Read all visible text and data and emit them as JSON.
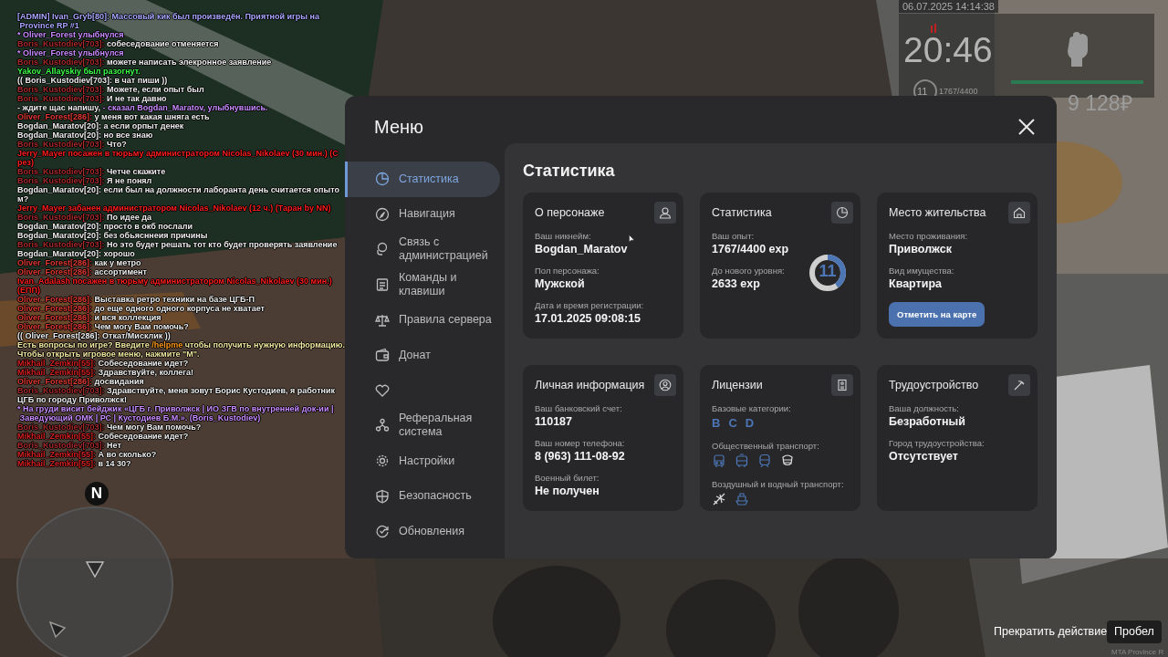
{
  "chat": [
    {
      "kind": "admin",
      "text": "[ADMIN] Ivan_Gryb[80]: Массовый кик был произведён. Приятной игры на"
    },
    {
      "kind": "admin",
      "text": " Province RP #1"
    },
    {
      "kind": "action",
      "text": "* Oliver_Forest улыбнулся"
    },
    {
      "kind": "say",
      "name": "Boris_Kustodiev[703]:",
      "color": "#a82a2a",
      "text": "собеседование отменяется"
    },
    {
      "kind": "action",
      "text": "* Oliver_Forest улыбнулся"
    },
    {
      "kind": "say",
      "name": "Boris_Kustodiev[703]:",
      "color": "#a82a2a",
      "text": "можете написать элекронное заявление"
    },
    {
      "kind": "event",
      "text": "Yakov_Allayskiy был разогнут."
    },
    {
      "kind": "ooc",
      "text": "(( Boris_Kustodiev[703]: в чат пиши ))"
    },
    {
      "kind": "say",
      "name": "Boris_Kustodiev[703]:",
      "color": "#a82a2a",
      "text": "Можете, если опыт был"
    },
    {
      "kind": "say",
      "name": "Boris_Kustodiev[703]:",
      "color": "#a82a2a",
      "text": "И не так давно"
    },
    {
      "kind": "speech",
      "text": "- ждите щас напишу,",
      "tail": "- сказал Bogdan_Maratov, улыбнувшись."
    },
    {
      "kind": "say",
      "name": "Oliver_Forest[286]:",
      "color": "#e03a30",
      "text": "у меня вот какая шняга есть"
    },
    {
      "kind": "say",
      "name": "Bogdan_Maratov[20]:",
      "color": "#eeeeee",
      "text": "а если орпыт денек"
    },
    {
      "kind": "say",
      "name": "Bogdan_Maratov[20]:",
      "color": "#eeeeee",
      "text": "но все знаю"
    },
    {
      "kind": "say",
      "name": "Boris_Kustodiev[703]:",
      "color": "#a82a2a",
      "text": "Что?"
    },
    {
      "kind": "punish",
      "text": "Jerry_Mayer посажен в тюрьму администратором Nicolas_Nikolaev (30 мин.) (С"
    },
    {
      "kind": "punish",
      "text": "рез)"
    },
    {
      "kind": "say",
      "name": "Boris_Kustodiev[703]:",
      "color": "#a82a2a",
      "text": "Четче скажите"
    },
    {
      "kind": "say",
      "name": "Boris_Kustodiev[703]:",
      "color": "#a82a2a",
      "text": "Я не понял"
    },
    {
      "kind": "say",
      "name": "Bogdan_Maratov[20]:",
      "color": "#eeeeee",
      "text": "если был на должности лаборанта день считается опыто"
    },
    {
      "kind": "ooc",
      "text": "м?"
    },
    {
      "kind": "punish",
      "text": "Jerry_Mayer забанен администратором Nicolas_Nikolaev (12 ч.) (Таран by NN)"
    },
    {
      "kind": "say",
      "name": "Boris_Kustodiev[703]:",
      "color": "#a82a2a",
      "text": "По идее да"
    },
    {
      "kind": "say",
      "name": "Bogdan_Maratov[20]:",
      "color": "#eeeeee",
      "text": "просто в окб послали"
    },
    {
      "kind": "say",
      "name": "Bogdan_Maratov[20]:",
      "color": "#eeeeee",
      "text": "без обьясннеия причины"
    },
    {
      "kind": "say",
      "name": "Boris_Kustodiev[703]:",
      "color": "#a82a2a",
      "text": "Но это будет решать тот кто будет проверять заявление"
    },
    {
      "kind": "say",
      "name": "Bogdan_Maratov[20]:",
      "color": "#eeeeee",
      "text": "хорошо"
    },
    {
      "kind": "say",
      "name": "Oliver_Forest[286]:",
      "color": "#e03a30",
      "text": "как у метро"
    },
    {
      "kind": "say",
      "name": "Oliver_Forest[286]:",
      "color": "#e03a30",
      "text": "ассортимент"
    },
    {
      "kind": "punish",
      "text": "Ivan_Adalash посажен в тюрьму администратором Nicolas_Nikolaev (30 мин.)"
    },
    {
      "kind": "punish",
      "text": "(ЕПП)"
    },
    {
      "kind": "say",
      "name": "Oliver_Forest[286]:",
      "color": "#e03a30",
      "text": "Выставка ретро техники на базе ЦГБ-П"
    },
    {
      "kind": "say",
      "name": "Oliver_Forest[286]:",
      "color": "#e03a30",
      "text": "до еще одного одного корпуса не хватает"
    },
    {
      "kind": "say",
      "name": "Oliver_Forest[286]:",
      "color": "#e03a30",
      "text": "и вся коллекция"
    },
    {
      "kind": "say",
      "name": "Oliver_Forest[286]:",
      "color": "#e03a30",
      "text": "Чем могу Вам помочь?"
    },
    {
      "kind": "ooc",
      "text": "(( Oliver_Forest[286]: Откат/Мисклик ))"
    },
    {
      "kind": "hint",
      "text": "Есть вопросы по игре? Введите",
      "command": "/helpme",
      "tail": "чтобы получить нужную информацию."
    },
    {
      "kind": "info",
      "text": "Чтобы открыть игровое меню, нажмите \"M\"."
    },
    {
      "kind": "say",
      "name": "Mikhail_Zemkin[55]:",
      "color": "#d42020",
      "text": "Собеседование идет?"
    },
    {
      "kind": "say",
      "name": "Mikhail_Zemkin[55]:",
      "color": "#d42020",
      "text": "Здравствуйте, коллега!"
    },
    {
      "kind": "say",
      "name": "Oliver_Forest[286]:",
      "color": "#e03a30",
      "text": "досвидания"
    },
    {
      "kind": "say",
      "name": "Boris_Kustodiev[703]:",
      "color": "#a82a2a",
      "text": "Здравствуйте, меня зовут Борис Кустодиев, я работник"
    },
    {
      "kind": "ooc",
      "text": "ЦГБ по городу Приволжск!"
    },
    {
      "kind": "action",
      "text": "* На груди висит бейджик «ЦГБ г. Приволжск | ИО ЗГВ по внутренней док-ии |"
    },
    {
      "kind": "action",
      "text": " Заведующий ОМК | РС | Кустодиев Б.М.». (Boris_Kustodiev)"
    },
    {
      "kind": "say",
      "name": "Boris_Kustodiev[703]:",
      "color": "#a82a2a",
      "text": "Чем могу Вам помочь?"
    },
    {
      "kind": "say",
      "name": "Mikhail_Zemkin[55]:",
      "color": "#d42020",
      "text": "Собеседование идет?"
    },
    {
      "kind": "say",
      "name": "Boris_Kustodiev[703]:",
      "color": "#a82a2a",
      "text": "Нет"
    },
    {
      "kind": "say",
      "name": "Mikhail_Zemkin[55]:",
      "color": "#d42020",
      "text": "А во сколько?"
    },
    {
      "kind": "say",
      "name": "Mikhail_Zemkin[55]:",
      "color": "#d42020",
      "text": "в 14 30?"
    }
  ],
  "hud": {
    "date": "06.07.2025 14:14:38",
    "clock": "20:46",
    "level": "11",
    "experience": "1767/4400",
    "money": "9 128₽"
  },
  "menu": {
    "title": "Меню",
    "sidebar": [
      {
        "kind": "stats",
        "label": "Статистика",
        "selected": true
      },
      {
        "kind": "navigation",
        "label": "Навигация",
        "selected": false
      },
      {
        "kind": "support",
        "label": "Связь с администрацией",
        "selected": false
      },
      {
        "kind": "commands",
        "label": "Команды и клавиши",
        "selected": false
      },
      {
        "kind": "rules",
        "label": "Правила сервера",
        "selected": false
      },
      {
        "kind": "donate",
        "label": "Донат",
        "selected": false
      },
      {
        "kind": "partner",
        "selected": false
      },
      {
        "kind": "referral",
        "label": "Реферальная система",
        "selected": false
      },
      {
        "kind": "settings",
        "label": "Настройки",
        "selected": false
      },
      {
        "kind": "security",
        "label": "Безопасность",
        "selected": false
      },
      {
        "kind": "updates",
        "label": "Обновления",
        "selected": false
      }
    ],
    "heading": "Статистика",
    "cards": [
      {
        "kind": "character",
        "title": "О персонаже",
        "fields": [
          {
            "label": "Ваш никнейм:",
            "value": "Bogdan_Maratov"
          },
          {
            "label": "Пол персонажа:",
            "value": "Мужской"
          },
          {
            "label": "Дата и время регистрации:",
            "value": "17.01.2025 09:08:15"
          }
        ]
      },
      {
        "kind": "stats",
        "title": "Статистика",
        "fields": [
          {
            "label": "Ваш опыт:",
            "value": "1767/4400 exp"
          },
          {
            "label": "До нового уровня:",
            "value": "2633 exp"
          }
        ],
        "ring": {
          "label": "11"
        }
      },
      {
        "kind": "residence",
        "title": "Место жительства",
        "fields": [
          {
            "label": "Место проживания:",
            "value": "Приволжск"
          },
          {
            "label": "Вид имущества:",
            "value": "Квартира"
          }
        ],
        "button": "Отметить на карте"
      },
      {
        "kind": "personal",
        "title": "Личная информация",
        "fields": [
          {
            "label": "Ваш банковский счет:",
            "value": "110187"
          },
          {
            "label": "Ваш номер телефона:",
            "value": "8 (963) 111-08-92"
          },
          {
            "label": "Военный билет:",
            "value": "Не получен"
          }
        ]
      },
      {
        "kind": "licenses",
        "title": "Лицензии",
        "groups": [
          {
            "kind": "letters",
            "label": "Базовые категории:",
            "items": [
              {
                "text": "B",
                "owned": true
              },
              {
                "text": "C",
                "owned": true
              },
              {
                "text": "D",
                "owned": true
              }
            ]
          },
          {
            "kind": "icons",
            "label": "Общественный транспорт:",
            "items": [
              {
                "kind": "bus",
                "owned": true
              },
              {
                "kind": "tram",
                "owned": true
              },
              {
                "kind": "train",
                "owned": true
              },
              {
                "kind": "other",
                "owned": false
              }
            ]
          },
          {
            "kind": "icons",
            "label": "Воздушный и водный транспорт:",
            "items": [
              {
                "kind": "plane",
                "owned": false
              },
              {
                "kind": "boat",
                "owned": true
              }
            ]
          }
        ]
      },
      {
        "kind": "job",
        "title": "Трудоустройство",
        "fields": [
          {
            "label": "Ваша должность:",
            "value": "Безработный"
          },
          {
            "label": "Город трудоустройства:",
            "value": "Отсутствует"
          }
        ]
      }
    ]
  },
  "minimap": {
    "north": "N"
  },
  "prompt": {
    "text": "Прекратить действие",
    "key": "Пробел"
  },
  "footer": "MTA Province R"
}
